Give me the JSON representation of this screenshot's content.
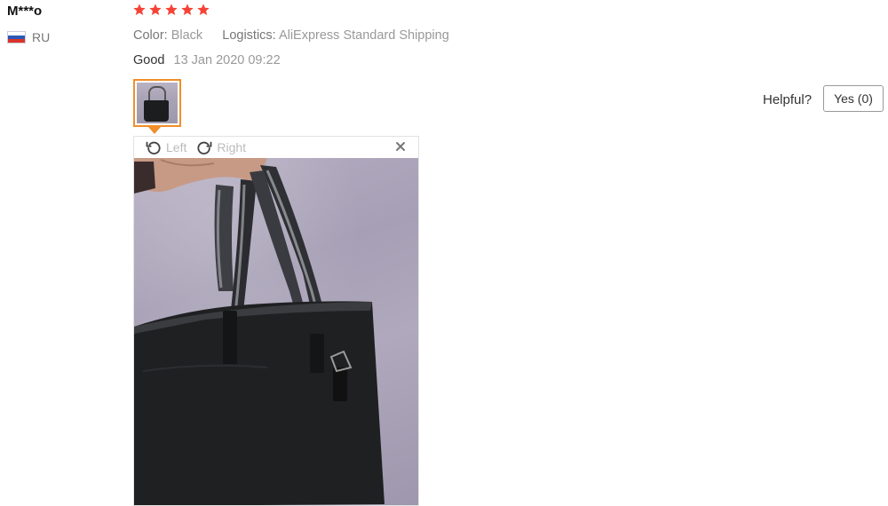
{
  "reviewer": {
    "name": "M***o",
    "country_code": "RU",
    "flag_colors": [
      "#ffffff",
      "#2c57b5",
      "#d9342b"
    ]
  },
  "rating": {
    "stars": 5,
    "max": 5,
    "color": "#f44336"
  },
  "attributes": {
    "color_label": "Color:",
    "color_value": "Black",
    "logistics_label": "Logistics:",
    "logistics_value": "AliExpress Standard Shipping"
  },
  "review": {
    "text": "Good",
    "date": "13 Jan 2020 09:22"
  },
  "thumbnail": {
    "selected": true,
    "accent": "#f08f2a"
  },
  "viewer": {
    "rotate_left_label": "Left",
    "rotate_right_label": "Right",
    "rotate_left_icon": "rotate-left-icon",
    "rotate_right_icon": "rotate-right-icon",
    "close_icon": "close-icon"
  },
  "helpful": {
    "question": "Helpful?",
    "yes_label": "Yes (0)"
  }
}
